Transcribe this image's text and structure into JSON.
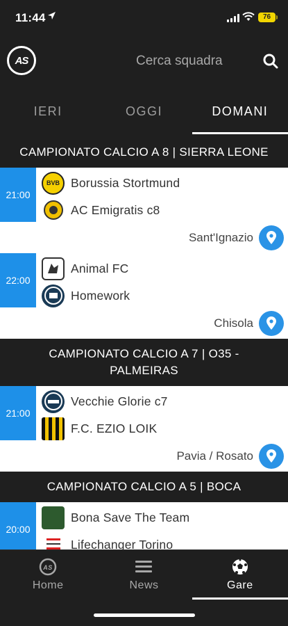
{
  "status": {
    "time": "11:44",
    "battery": "76"
  },
  "header": {
    "search_placeholder": "Cerca squadra",
    "logo_text": "AS"
  },
  "tabs": [
    {
      "label": "IERI",
      "active": false
    },
    {
      "label": "OGGI",
      "active": false
    },
    {
      "label": "DOMANI",
      "active": true
    }
  ],
  "leagues": [
    {
      "title": "CAMPIONATO CALCIO A 8 | SIERRA LEONE",
      "matches": [
        {
          "time": "21:00",
          "home": "Borussia Stortmund",
          "away": "AC Emigratis c8",
          "venue": "Sant'Ignazio"
        },
        {
          "time": "22:00",
          "home": "Animal FC",
          "away": "Homework",
          "venue": "Chisola"
        }
      ]
    },
    {
      "title": "CAMPIONATO CALCIO A 7 | O35 - PALMEIRAS",
      "matches": [
        {
          "time": "21:00",
          "home": "Vecchie Glorie c7",
          "away": "F.C. EZIO LOIK",
          "venue": "Pavia / Rosato"
        }
      ]
    },
    {
      "title": "CAMPIONATO CALCIO A 5 | BOCA",
      "matches": [
        {
          "time": "20:00",
          "home": "Bona Save The Team",
          "away": "Lifechanger Torino",
          "venue": ""
        }
      ]
    }
  ],
  "nav": [
    {
      "label": "Home",
      "icon": "home-logo-icon",
      "active": false
    },
    {
      "label": "News",
      "icon": "list-icon",
      "active": false
    },
    {
      "label": "Gare",
      "icon": "soccer-ball-icon",
      "active": true
    }
  ],
  "colors": {
    "accent": "#1e90e8",
    "background": "#1f1f1f",
    "battery": "#f2d600"
  }
}
